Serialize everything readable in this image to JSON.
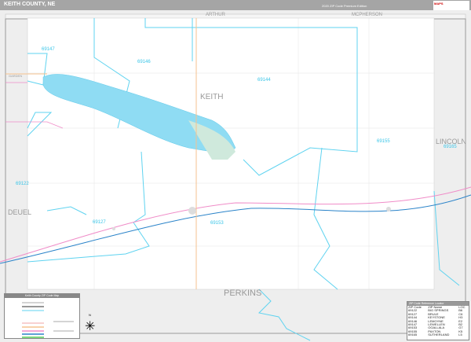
{
  "header": {
    "title": "KEITH COUNTY, NE",
    "edition": "2020 ZIP Code Premium Edition",
    "logo": "MAPS"
  },
  "neighbors": {
    "north1": "ARTHUR",
    "north2": "MCPHERSON",
    "west_top": "GARDEN",
    "west": "DEUEL",
    "east": "LINCOLN",
    "south": "PERKINS"
  },
  "county_label": "KEITH",
  "zip_labels": [
    "69147",
    "69146",
    "69144",
    "69155",
    "69165",
    "69122",
    "69127",
    "69153"
  ],
  "legend": {
    "title": "Keith County ZIP Code Map"
  },
  "zip_table": {
    "title": "ZIP Code Reference Locator",
    "columns": [
      "ZIP Code",
      "ZIP Name",
      "LOC"
    ],
    "rows": [
      [
        "69122",
        "BIG SPRINGS",
        "B6"
      ],
      [
        "69127",
        "BRULE",
        "C6"
      ],
      [
        "69144",
        "KEYSTONE",
        "H3"
      ],
      [
        "69146",
        "LEMOYNE",
        "E2"
      ],
      [
        "69147",
        "LEWELLEN",
        "B2"
      ],
      [
        "69153",
        "OGALLALA",
        "G7"
      ],
      [
        "69155",
        "PAXTON",
        "K5"
      ],
      [
        "69165",
        "SUTHERLAND",
        "L5"
      ]
    ]
  },
  "compass": "N"
}
